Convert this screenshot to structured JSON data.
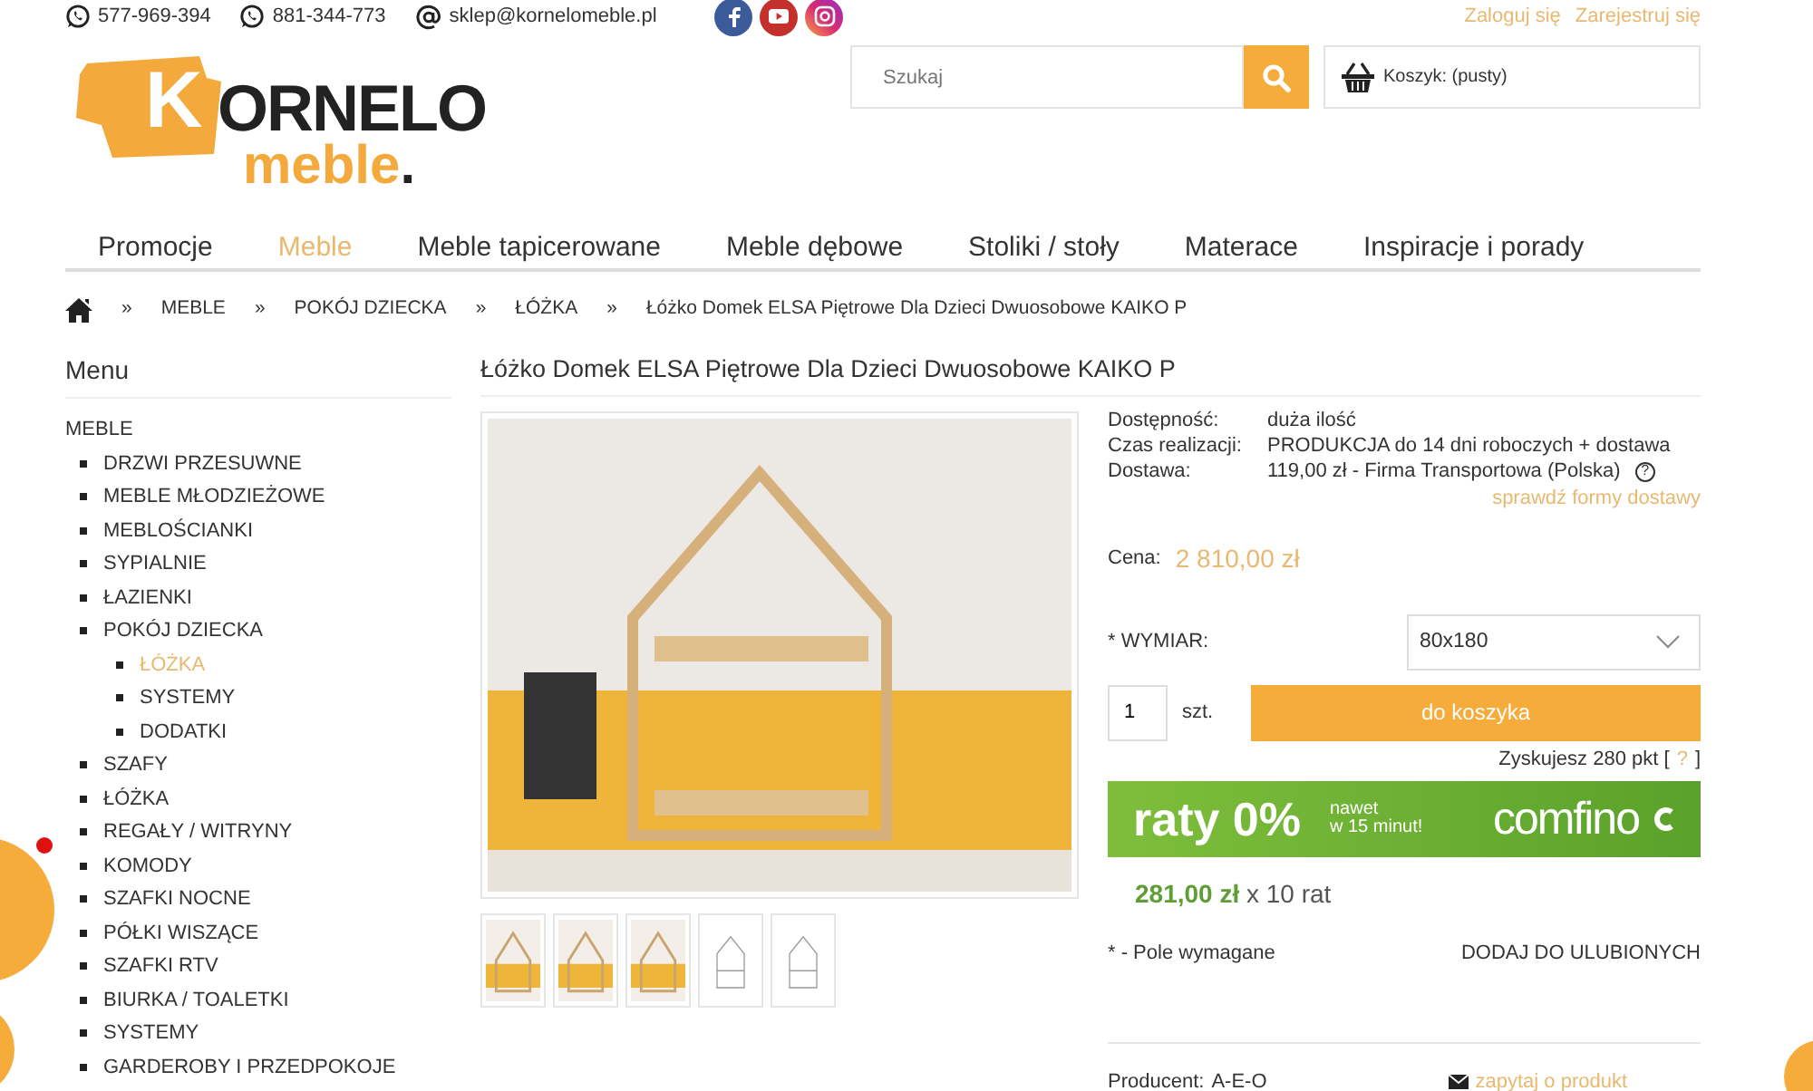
{
  "topbar": {
    "contacts": [
      {
        "kind": "whatsapp",
        "text": "577-969-394"
      },
      {
        "kind": "whatsapp",
        "text": "881-344-773"
      },
      {
        "kind": "email",
        "text": "sklep@kornelomeble.pl"
      }
    ],
    "social": [
      {
        "kind": "facebook"
      },
      {
        "kind": "youtube"
      },
      {
        "kind": "instagram"
      }
    ],
    "account_links": [
      "Zaloguj się",
      "Zarejestruj się"
    ]
  },
  "logo": {
    "initial": "K",
    "name": "ORNELO",
    "tagline": "meble",
    "dot": "."
  },
  "search": {
    "placeholder": "Szukaj"
  },
  "cart": {
    "label": "Koszyk: (pusty)"
  },
  "nav": [
    {
      "label": "Promocje",
      "selected": false
    },
    {
      "label": "Meble",
      "selected": true
    },
    {
      "label": "Meble tapicerowane",
      "selected": false
    },
    {
      "label": "Meble dębowe",
      "selected": false
    },
    {
      "label": "Stoliki / stoły",
      "selected": false
    },
    {
      "label": "Materace",
      "selected": false
    },
    {
      "label": "Inspiracje i porady",
      "selected": false
    }
  ],
  "breadcrumb": {
    "separator": "»",
    "items": [
      "MEBLE",
      "POKÓJ DZIECKA",
      "ŁÓŻKA",
      "Łóżko Domek ELSA Piętrowe Dla Dzieci Dwuosobowe KAIKO P"
    ]
  },
  "sidebar": {
    "title": "Menu",
    "root": "MEBLE",
    "items": [
      {
        "label": "DRZWI PRZESUWNE",
        "selected": false
      },
      {
        "label": "MEBLE MŁODZIEŻOWE",
        "selected": false
      },
      {
        "label": "MEBLOŚCIANKI",
        "selected": false
      },
      {
        "label": "SYPIALNIE",
        "selected": false
      },
      {
        "label": "ŁAZIENKI",
        "selected": false
      },
      {
        "label": "POKÓJ DZIECKA",
        "selected": false,
        "children": [
          {
            "label": "ŁÓŻKA",
            "selected": true
          },
          {
            "label": "SYSTEMY",
            "selected": false
          },
          {
            "label": "DODATKI",
            "selected": false
          }
        ]
      },
      {
        "label": "SZAFY",
        "selected": false
      },
      {
        "label": "ŁÓŻKA",
        "selected": false
      },
      {
        "label": "REGAŁY / WITRYNY",
        "selected": false
      },
      {
        "label": "KOMODY",
        "selected": false
      },
      {
        "label": "SZAFKI NOCNE",
        "selected": false
      },
      {
        "label": "PÓŁKI WISZĄCE",
        "selected": false
      },
      {
        "label": "SZAFKI RTV",
        "selected": false
      },
      {
        "label": "BIURKA / TOALETKI",
        "selected": false
      },
      {
        "label": "SYSTEMY",
        "selected": false
      },
      {
        "label": "GARDEROBY I PRZEDPOKOJE",
        "selected": false
      }
    ]
  },
  "product": {
    "title": "Łóżko Domek ELSA Piętrowe Dla Dzieci Dwuosobowe KAIKO P",
    "thumbnails": [
      {
        "kind": "photo"
      },
      {
        "kind": "photo"
      },
      {
        "kind": "photo"
      },
      {
        "kind": "drawing"
      },
      {
        "kind": "drawing"
      }
    ],
    "details": [
      {
        "label": "Dostępność:",
        "value": "duża ilość"
      },
      {
        "label": "Czas realizacji:",
        "value": "PRODUKCJA do 14 dni roboczych + dostawa"
      },
      {
        "label": "Dostawa:",
        "value": "119,00 zł - Firma Transportowa (Polska)",
        "help_icon": "?"
      }
    ],
    "delivery_link": "sprawdź formy dostawy",
    "price_label": "Cena:",
    "price": "2 810,00 zł",
    "option_label": "* WYMIAR:",
    "option_value": "80x180",
    "quantity": "1",
    "unit": "szt.",
    "add_button": "do koszyka",
    "points": {
      "before": "Zyskujesz 280 pkt [",
      "help": "?",
      "after": "]"
    },
    "installments_banner": {
      "headline": "raty 0%",
      "sub1": "nawet",
      "sub2": "w 15 minut!",
      "brand": "comfino"
    },
    "installment": {
      "amount": "281,00 zł",
      "rest": "x 10 rat"
    },
    "required_note": "* - Pole wymagane",
    "favorite": "DODAJ DO ULUBIONYCH",
    "producer_label": "Producent:",
    "producer": "A-E-O",
    "ask_link": "zapytaj o produkt"
  }
}
